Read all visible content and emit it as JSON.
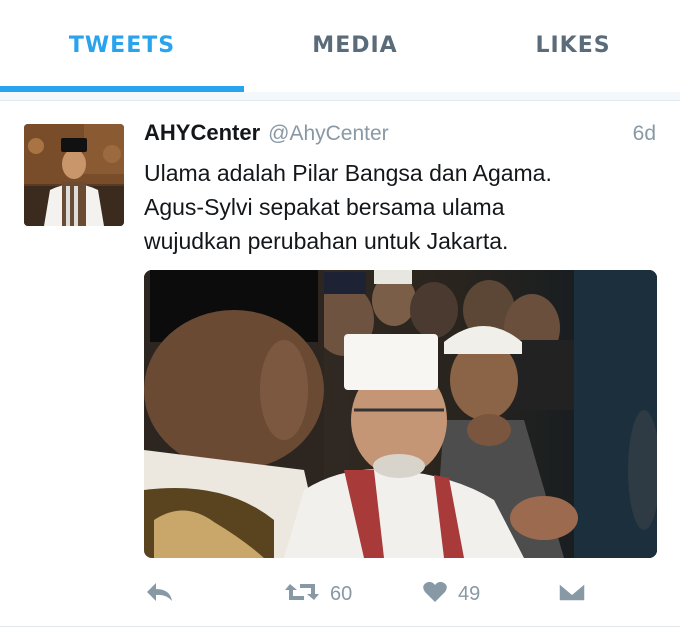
{
  "tabs": [
    {
      "label": "TWEETS",
      "selected": true
    },
    {
      "label": "MEDIA",
      "selected": false
    },
    {
      "label": "LIKES",
      "selected": false
    }
  ],
  "tweet": {
    "display_name": "AHYCenter",
    "handle": "@AhyCenter",
    "time": "6d",
    "text_lines": [
      "Ulama adalah Pilar Bangsa dan Agama.",
      "Agus-Sylvi sepakat bersama ulama",
      "wujudkan perubahan untuk Jakarta."
    ],
    "retweets": "60",
    "likes": "49"
  },
  "icons": {
    "reply": "reply-icon",
    "retweet": "retweet-icon",
    "like": "heart-icon",
    "dm": "envelope-icon"
  },
  "colors": {
    "accent": "#2aa3ef",
    "muted": "#8899a6",
    "text": "#14171a"
  }
}
